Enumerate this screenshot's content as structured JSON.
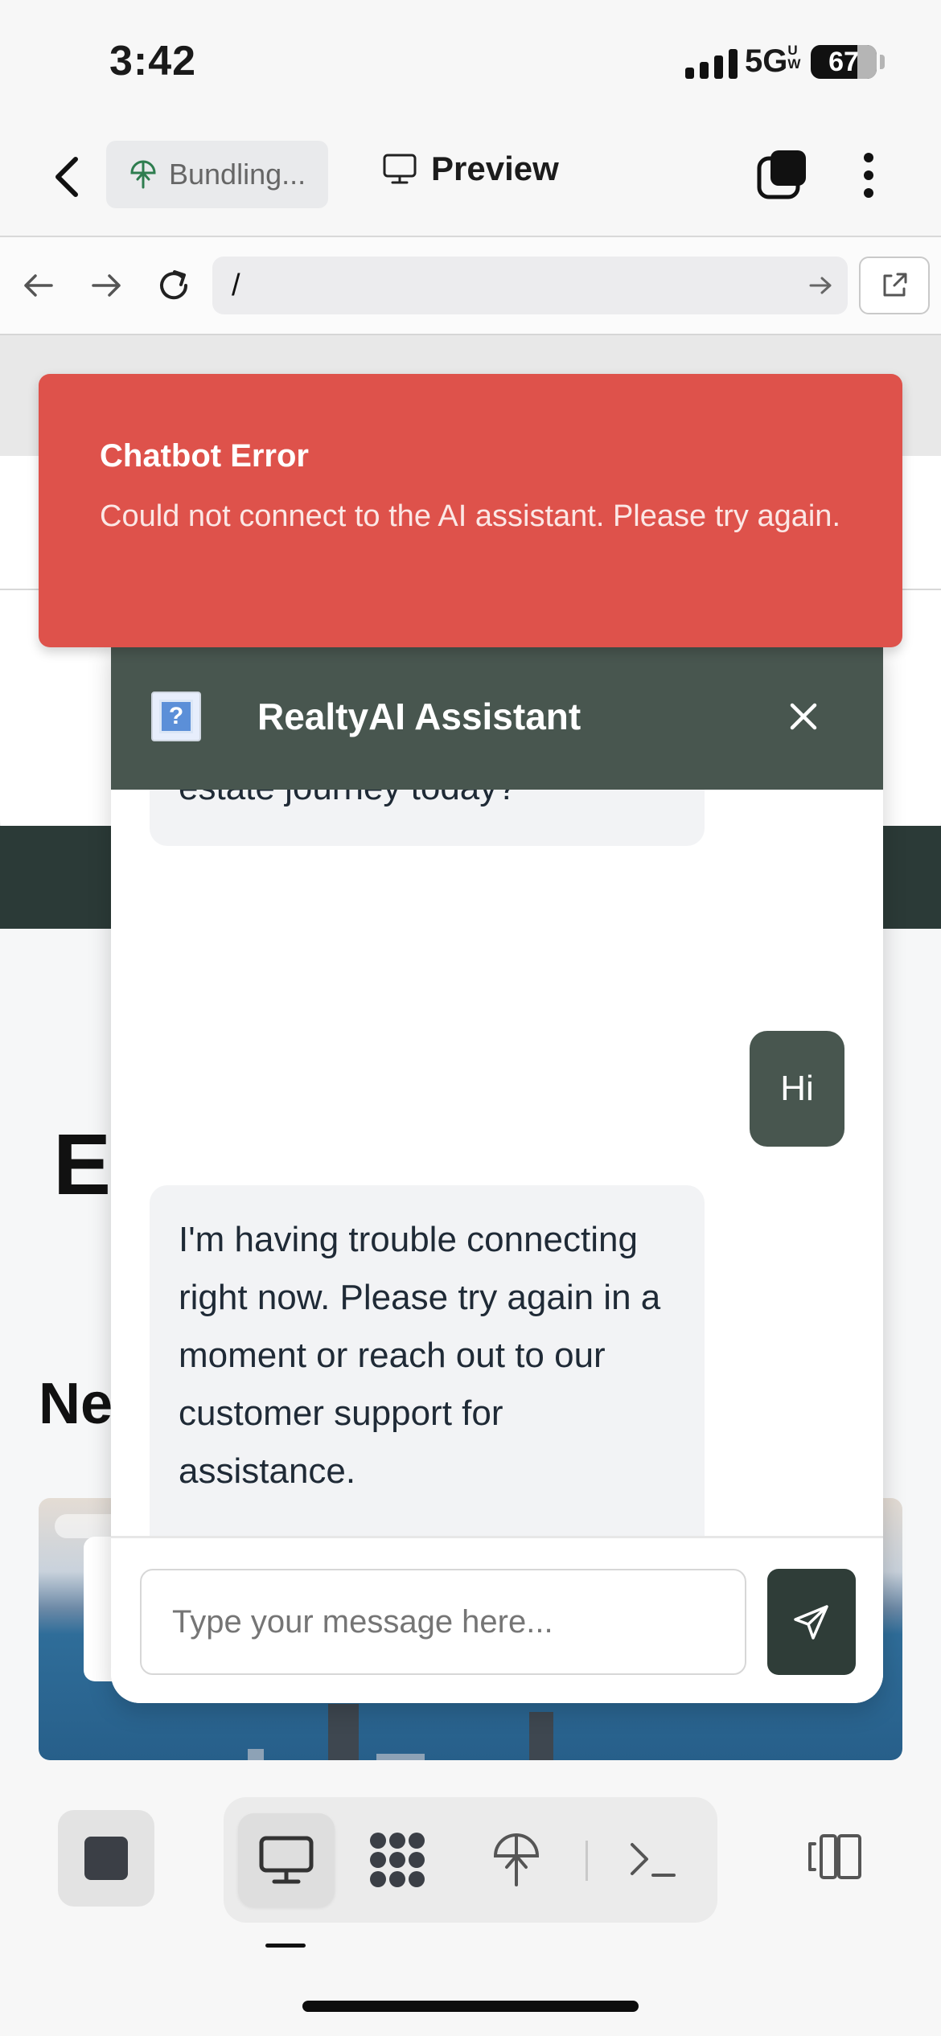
{
  "status_bar": {
    "time": "3:42",
    "network": "5G",
    "network_suffix": "UW",
    "battery": "67"
  },
  "header": {
    "deploy_chip_label": "Bundling...",
    "preview_label": "Preview"
  },
  "url_bar": {
    "url": "/"
  },
  "toast": {
    "title": "Chatbot Error",
    "message": "Could not connect to the AI assistant. Please try again.",
    "color": "#de524b"
  },
  "chat": {
    "title": "RealtyAI Assistant",
    "header_color": "#48564f",
    "messages": [
      {
        "role": "assistant",
        "text": "estate journey today?"
      },
      {
        "role": "user",
        "text": "Hi"
      },
      {
        "role": "assistant",
        "text": "I'm having trouble connecting right now. Please try again in a moment or reach out to our customer support for assistance."
      }
    ],
    "input_placeholder": "Type your message here..."
  },
  "background_page": {
    "heading_fragment": "Ex",
    "subheading_fragment": "Ne"
  },
  "toolbar": {
    "icons": [
      "stop-icon",
      "monitor-icon",
      "extensions-icon",
      "deploy-icon",
      "terminal-icon",
      "panel-toggle-icon"
    ],
    "active": "monitor-icon"
  }
}
